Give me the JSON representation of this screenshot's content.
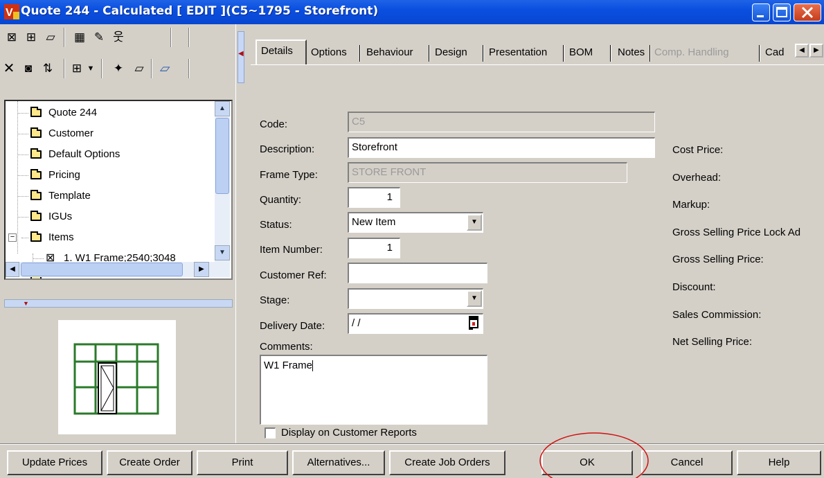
{
  "window": {
    "title": "Quote 244 - Calculated  [ EDIT ](C5~1795 - Storefront)",
    "icon": "app-logo-icon"
  },
  "tree": {
    "items": [
      {
        "label": "Quote 244"
      },
      {
        "label": "Customer"
      },
      {
        "label": "Default Options"
      },
      {
        "label": "Pricing"
      },
      {
        "label": "Template"
      },
      {
        "label": "IGUs"
      },
      {
        "label": "Items"
      },
      {
        "label": "1. W1 Frame;2540;3048"
      }
    ],
    "expand_glyph": "−"
  },
  "tabs": [
    "Details",
    "Options",
    "Behaviour",
    "Design",
    "Presentation",
    "BOM",
    "Notes",
    "Comp. Handling",
    "Cad"
  ],
  "form": {
    "code_label": "Code:",
    "code_value": "C5",
    "description_label": "Description:",
    "description_value": "Storefront",
    "frame_type_label": "Frame Type:",
    "frame_type_value": "STORE FRONT",
    "quantity_label": "Quantity:",
    "quantity_value": "1",
    "status_label": "Status:",
    "status_value": "New Item",
    "item_number_label": "Item Number:",
    "item_number_value": "1",
    "customer_ref_label": "Customer Ref:",
    "customer_ref_value": "",
    "stage_label": "Stage:",
    "stage_value": "",
    "delivery_date_label": "Delivery Date:",
    "delivery_date_value": " / /",
    "comments_label": "Comments:",
    "comments_value": "W1 Frame",
    "display_label": "Display on Customer Reports"
  },
  "pricing": {
    "cost_price": "Cost Price:",
    "overhead": "Overhead:",
    "markup": "Markup:",
    "gross_lock": "Gross Selling Price Lock Ad",
    "gross": "Gross Selling Price:",
    "discount": "Discount:",
    "commission": "Sales Commission:",
    "net": "Net Selling Price:"
  },
  "buttons": {
    "update_prices": "Update Prices",
    "create_order": "Create Order",
    "print": "Print",
    "alternatives": "Alternatives...",
    "create_job_orders": "Create Job Orders",
    "ok": "OK",
    "cancel": "Cancel",
    "help": "Help"
  }
}
